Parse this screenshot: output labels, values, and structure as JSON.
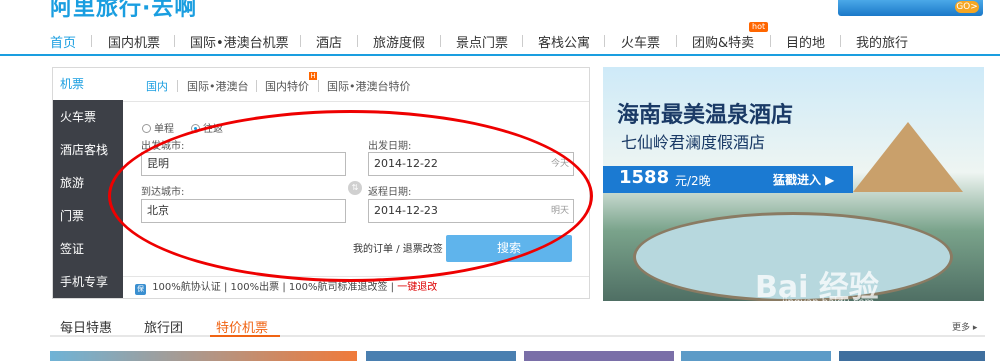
{
  "header": {
    "logo_text": "阿里旅行·去啊",
    "banner_go": "GO>"
  },
  "nav": {
    "items": [
      "首页",
      "国内机票",
      "国际•港澳台机票",
      "酒店",
      "旅游度假",
      "景点门票",
      "客栈公寓",
      "火车票",
      "团购&特卖",
      "目的地",
      "我的旅行"
    ],
    "hot_badge": "hot",
    "active_index": 0
  },
  "sidebar": {
    "items": [
      "机票",
      "火车票",
      "酒店客栈",
      "旅游",
      "门票",
      "签证",
      "手机专享"
    ],
    "active_index": 0
  },
  "flight_tabs": {
    "items": [
      "国内",
      "国际•港澳台",
      "国内特价",
      "国际•港澳台特价"
    ],
    "active_index": 0,
    "special_mark": "H"
  },
  "trip_type": {
    "one_way": "单程",
    "round_trip": "往返",
    "selected": "round_trip"
  },
  "form": {
    "from_label": "出发城市:",
    "from_value": "昆明",
    "to_label": "到达城市:",
    "to_value": "北京",
    "depart_label": "出发日期:",
    "depart_value": "2014-12-22",
    "depart_hint": "今天",
    "return_label": "返程日期:",
    "return_value": "2014-12-23",
    "return_hint": "明天",
    "swap_icon": "⇅"
  },
  "actions": {
    "my_orders": "我的订单",
    "refund": "退票改签",
    "search": "搜索"
  },
  "guarantees": {
    "shield_label": "保",
    "items": [
      "100%航协认证",
      "100%出票",
      "100%航司标准退改签",
      "一键退改"
    ]
  },
  "ad": {
    "title": "海南最美温泉酒店",
    "subtitle": "七仙岭君澜度假酒店",
    "price": "1588",
    "unit": "元/2晚",
    "cta": "猛戳进入 ▶"
  },
  "watermark": {
    "text": "Bai 经验",
    "url": "jingyan.baidu.com"
  },
  "bottom_tabs": {
    "items": [
      "每日特惠",
      "旅行团",
      "特价机票"
    ],
    "active_index": 2,
    "more": "更多 ▸"
  },
  "colors": {
    "accent": "#1a9ee0",
    "sidebar_bg": "#3d4047",
    "highlight_oval": "#e00000",
    "tab_active": "#f06414"
  }
}
